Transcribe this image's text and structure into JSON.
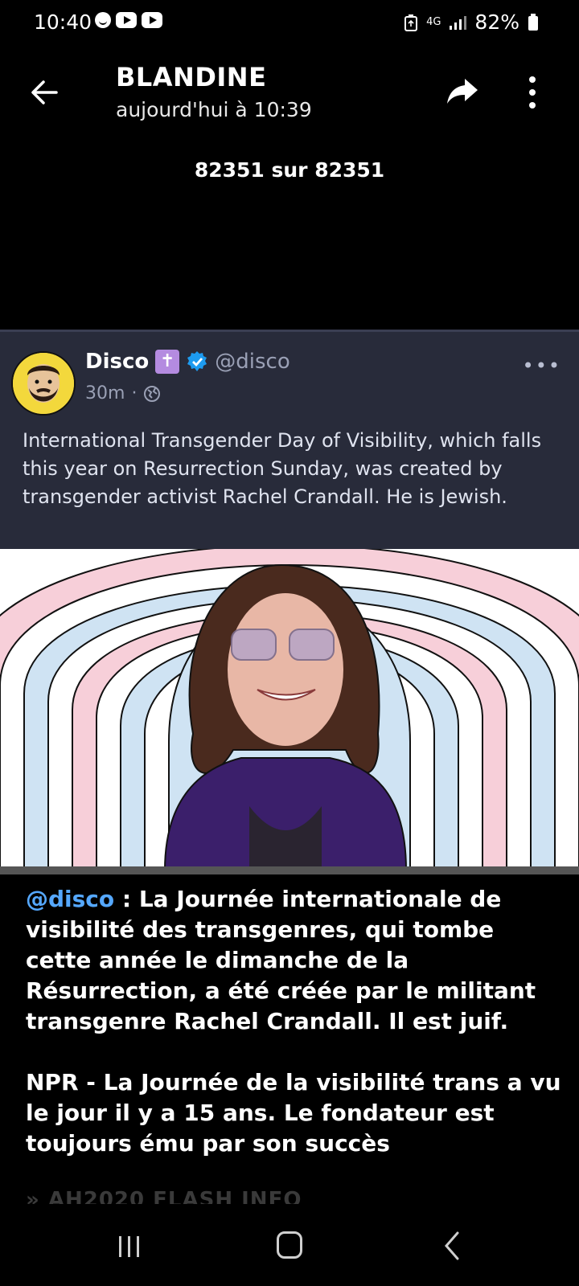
{
  "status_bar": {
    "time": "10:40",
    "network": "4G",
    "battery": "82%",
    "icons": [
      "smiley-icon",
      "youtube-icon",
      "youtube-icon"
    ]
  },
  "header": {
    "title": "BLANDINE",
    "subtitle": "aujourd'hui à 10:39",
    "counter": "82351 sur 82351"
  },
  "post": {
    "author": "Disco",
    "author_badge": "✝",
    "handle": "@disco",
    "time_ago": "30m",
    "separator": "·",
    "more": "•••",
    "text": "International Transgender Day of Visibility, which falls this year on Resurrection Sunday, was created by transgender activist Rachel Crandall. He is Jewish.",
    "colors": {
      "card_bg": "#282b3a",
      "stripe_pink": "#f7cfd9",
      "stripe_blue": "#cfe3f3"
    }
  },
  "caption": {
    "link": "@disco",
    "text": " : La Journée internationale de visibilité des transgenres, qui tombe cette année le dimanche de la Résurrection, a été créée par le militant transgenre Rachel Crandall. Il est juif.",
    "link2": "NPR",
    "text2": " - La Journée de la visibilité trans a vu le jour il y a 15 ans. Le fondateur est toujours ému par son succès",
    "faded": "» AH2020 FLASH INFO"
  },
  "nav": {
    "recent": "recent-apps-icon",
    "home": "home-icon",
    "back": "back-icon"
  }
}
